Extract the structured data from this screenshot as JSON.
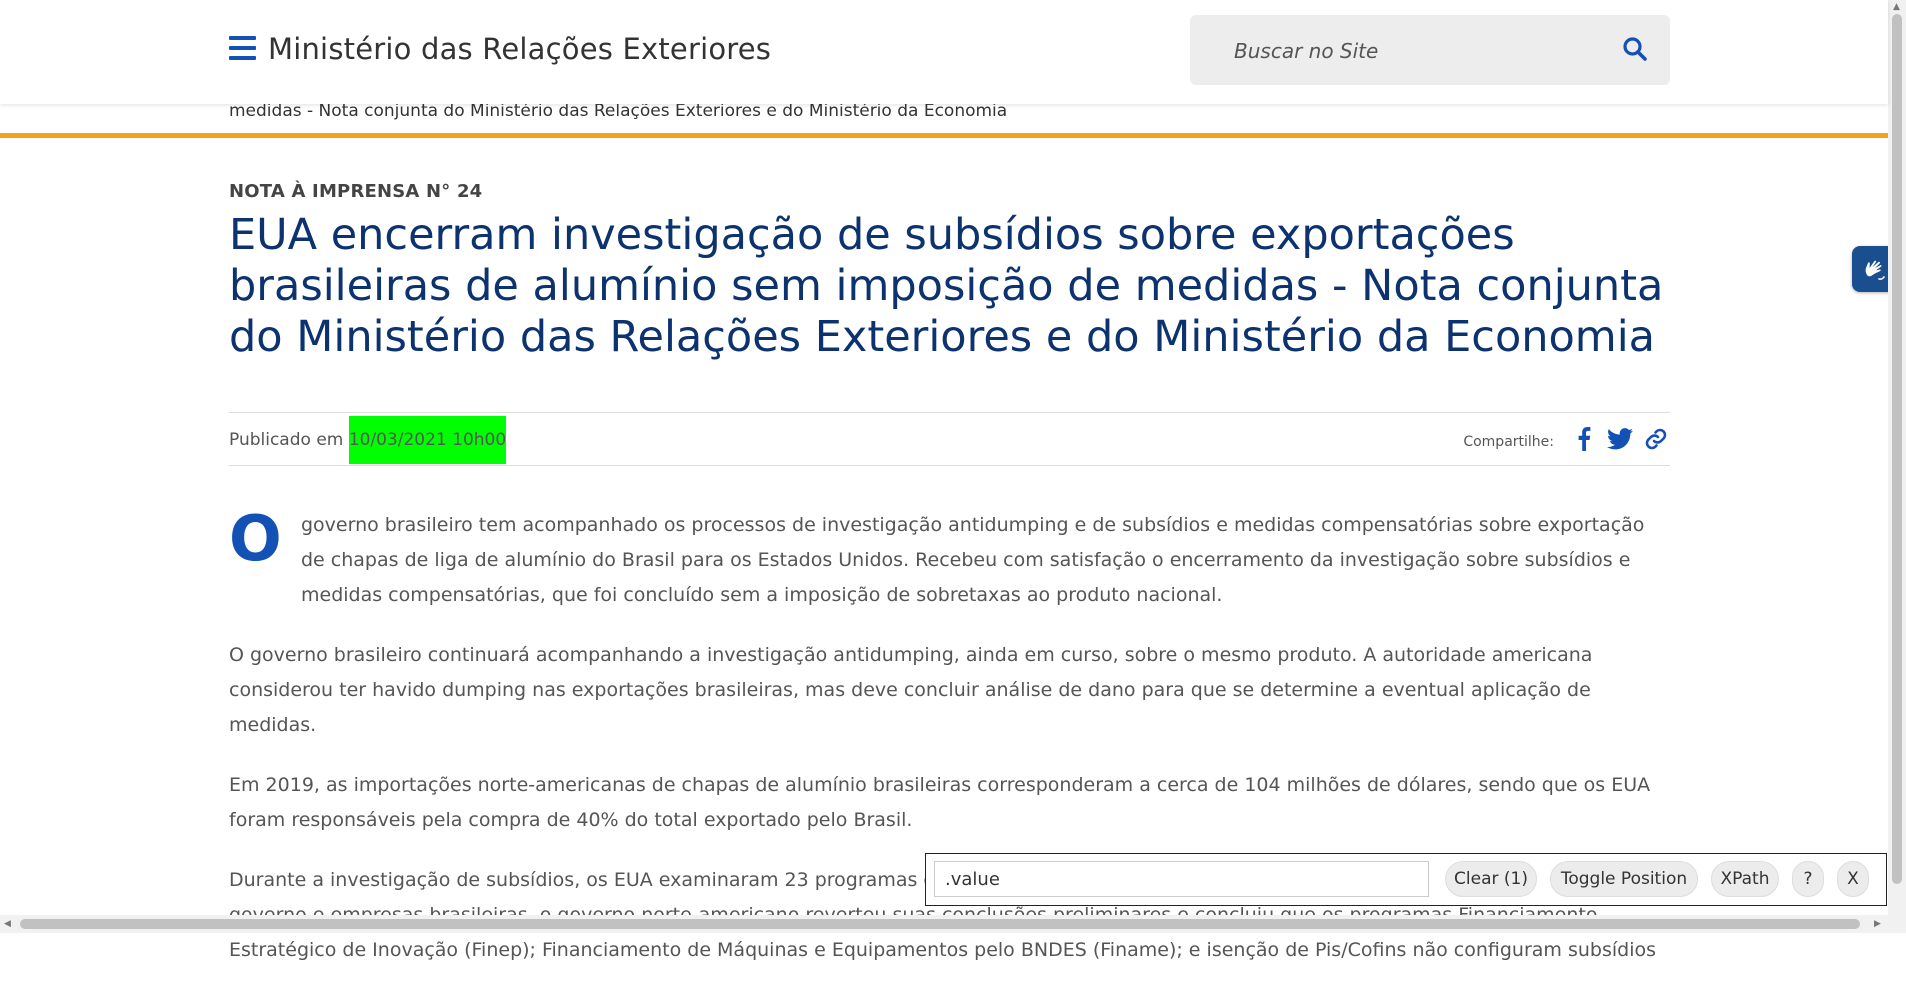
{
  "header": {
    "site_title": "Ministério das Relações Exteriores",
    "search_placeholder": "Buscar no Site"
  },
  "breadcrumb_current": "medidas - Nota conjunta do Ministério das Relações Exteriores e do Ministério da Economia",
  "article": {
    "kicker": "NOTA À IMPRENSA N° 24",
    "title": "EUA encerram investigação de subsídios sobre exportações brasileiras de alumínio sem imposição de medidas - Nota conjunta do Ministério das Relações Exteriores e do Ministério da Economia",
    "published_label": "Publicado em",
    "published_date": "10/03/2021 10h00",
    "share_label": "Compartilhe:",
    "dropcap": "O",
    "paragraph1": "governo brasileiro tem acompanhado os processos de investigação antidumping e de subsídios e medidas compensatórias sobre exportação de chapas de liga de alumínio do Brasil para os Estados Unidos. Recebeu com satisfação o encerramento da investigação sobre subsídios e medidas compensatórias, que foi concluído sem a imposição de sobretaxas ao produto nacional.",
    "paragraph2": "O governo brasileiro continuará acompanhando a investigação antidumping, ainda em curso, sobre o mesmo produto. A autoridade americana considerou ter havido dumping nas exportações brasileiras, mas deve concluir análise de dano para que se determine a eventual aplicação de medidas.",
    "paragraph3": "Em 2019, as importações norte-americanas de chapas de alumínio brasileiras corresponderam a cerca de 104 milhões de dólares, sendo que os EUA foram responsáveis pela compra de 40% do total exportado pelo Brasil.",
    "paragraph4": "Durante a investigação de subsídios, os EUA examinaram 23 programas governamentais brasileiros. Com base nos argumentos apresentados pelo governo e empresas brasileiras, o governo norte-americano reverteu suas conclusões preliminares e concluiu que os programas Financiamento Estratégico de Inovação (Finep); Financiamento de Máquinas e Equipamentos pelo BNDES (Finame); e isenção de Pis/Cofins não configuram subsídios"
  },
  "tool": {
    "input_value": ".value",
    "clear_label": "Clear (1)",
    "toggle_label": "Toggle Position",
    "xpath_label": "XPath",
    "help_label": "?",
    "close_label": "X"
  },
  "colors": {
    "brand_blue": "#1351b4",
    "title_navy": "#0c326f",
    "accent_orange": "#f4a21c",
    "highlight_green": "#00ff00"
  },
  "icons": [
    "menu-icon",
    "search-icon",
    "facebook-icon",
    "twitter-icon",
    "link-icon",
    "libras-hand-icon"
  ]
}
